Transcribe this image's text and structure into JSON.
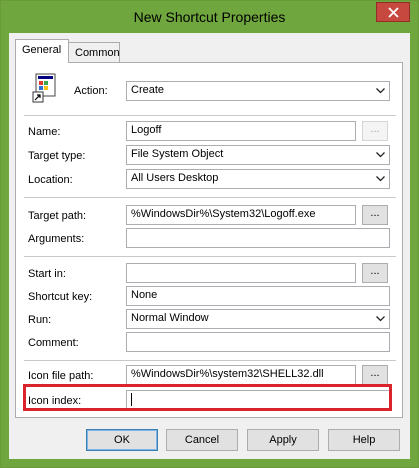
{
  "window": {
    "title": "New Shortcut Properties"
  },
  "tabs": [
    {
      "label": "General",
      "active": true
    },
    {
      "label": "Common",
      "active": false
    }
  ],
  "form": {
    "action": {
      "label": "Action:",
      "value": "Create"
    },
    "name": {
      "label": "Name:",
      "value": "Logoff",
      "browse": "..."
    },
    "target_type": {
      "label": "Target type:",
      "value": "File System Object"
    },
    "location": {
      "label": "Location:",
      "value": "All Users Desktop"
    },
    "target_path": {
      "label": "Target path:",
      "value": "%WindowsDir%\\System32\\Logoff.exe",
      "browse": "..."
    },
    "arguments": {
      "label": "Arguments:",
      "value": ""
    },
    "start_in": {
      "label": "Start in:",
      "value": "",
      "browse": "..."
    },
    "shortcut_key": {
      "label": "Shortcut key:",
      "value": "None"
    },
    "run": {
      "label": "Run:",
      "value": "Normal Window"
    },
    "comment": {
      "label": "Comment:",
      "value": ""
    },
    "icon_file_path": {
      "label": "Icon file path:",
      "value": "%WindowsDir%\\system32\\SHELL32.dll",
      "browse": "..."
    },
    "icon_index": {
      "label": "Icon index:",
      "value": ""
    }
  },
  "buttons": {
    "ok": "OK",
    "cancel": "Cancel",
    "apply": "Apply",
    "help": "Help"
  },
  "colors": {
    "title_bar": "#6fa63d",
    "close_button": "#c7483e",
    "highlight_box": "#d9242b"
  }
}
